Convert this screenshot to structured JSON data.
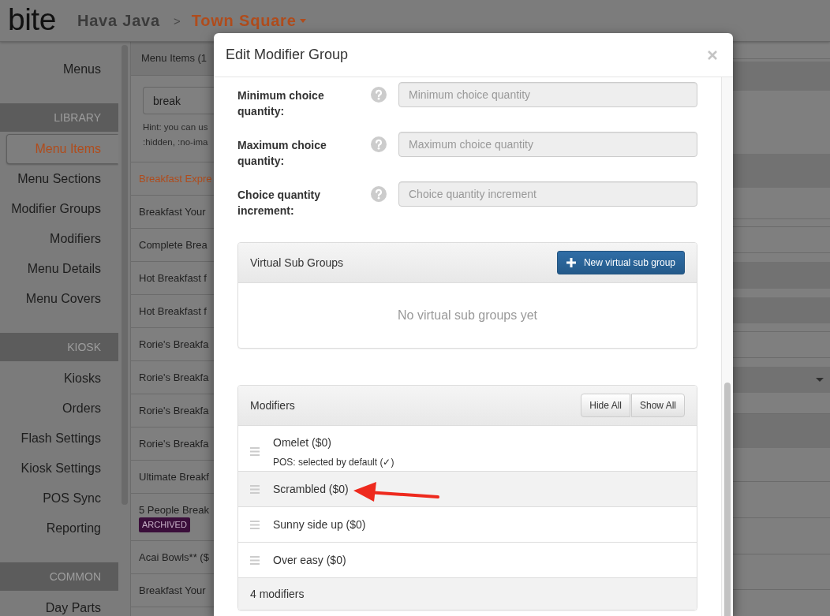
{
  "header": {
    "logo": "bite",
    "account": "Hava Java",
    "separator": ">",
    "location": "Town Square"
  },
  "sidebar": {
    "groups": [
      {
        "items": [
          {
            "label": "Menus",
            "selected": false
          }
        ]
      },
      {
        "heading": "LIBRARY",
        "items": [
          {
            "label": "Menu Items",
            "selected": true
          },
          {
            "label": "Menu Sections",
            "selected": false
          },
          {
            "label": "Modifier Groups",
            "selected": false
          },
          {
            "label": "Modifiers",
            "selected": false
          },
          {
            "label": "Menu Details",
            "selected": false
          },
          {
            "label": "Menu Covers",
            "selected": false
          }
        ]
      },
      {
        "heading": "KIOSK",
        "items": [
          {
            "label": "Kiosks",
            "selected": false
          },
          {
            "label": "Orders",
            "selected": false
          },
          {
            "label": "Flash Settings",
            "selected": false
          },
          {
            "label": "Kiosk Settings",
            "selected": false
          },
          {
            "label": "POS Sync",
            "selected": false
          },
          {
            "label": "Reporting",
            "selected": false
          }
        ]
      },
      {
        "heading": "COMMON",
        "items": [
          {
            "label": "Day Parts",
            "selected": false
          }
        ]
      }
    ]
  },
  "item_list": {
    "title": "Menu Items (1",
    "search": {
      "value": "break"
    },
    "hint_lines": [
      "Hint: you can us",
      ":hidden, :no-ima"
    ],
    "items": [
      {
        "label": "Breakfast Expre",
        "selected": true
      },
      {
        "label": "Breakfast Your",
        "selected": false
      },
      {
        "label": "Complete Brea",
        "selected": false
      },
      {
        "label": "Hot Breakfast f",
        "selected": false
      },
      {
        "label": "Hot Breakfast f",
        "selected": false
      },
      {
        "label": "Rorie's Breakfa",
        "selected": false
      },
      {
        "label": "Rorie's Breakfa",
        "selected": false
      },
      {
        "label": "Rorie's Breakfa",
        "selected": false
      },
      {
        "label": "Rorie's Breakfa",
        "selected": false
      },
      {
        "label": "Ultimate Breakf",
        "selected": false
      },
      {
        "label": "5 People Break",
        "selected": false,
        "badge": "ARCHIVED"
      },
      {
        "label": "Acai Bowls** ($",
        "selected": false
      },
      {
        "label": "Breakfast Your",
        "selected": false
      }
    ]
  },
  "modal": {
    "title": "Edit Modifier Group",
    "fields": [
      {
        "label": "Minimum choice quantity:",
        "placeholder": "Minimum choice quantity",
        "disabled": true
      },
      {
        "label": "Maximum choice quantity:",
        "placeholder": "Maximum choice quantity",
        "disabled": true
      },
      {
        "label": "Choice quantity increment:",
        "placeholder": "Choice quantity increment",
        "disabled": true
      }
    ],
    "virtual_sub_groups": {
      "title": "Virtual Sub Groups",
      "button": "New virtual sub group",
      "empty_text": "No virtual sub groups yet"
    },
    "modifiers": {
      "title": "Modifiers",
      "buttons": [
        "Hide All",
        "Show All"
      ],
      "items": [
        {
          "name": "Omelet ($0)",
          "note": "POS: selected by default (✓)",
          "highlighted": false
        },
        {
          "name": "Scrambled ($0)",
          "highlighted": true
        },
        {
          "name": "Sunny side up ($0)",
          "highlighted": false
        },
        {
          "name": "Over easy ($0)",
          "highlighted": false
        }
      ],
      "footer": "4 modifiers"
    }
  }
}
